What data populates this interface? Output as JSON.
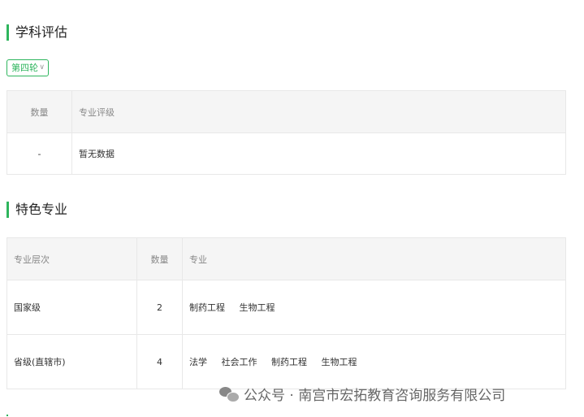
{
  "assessment": {
    "title": "学科评估",
    "round_select": "第四轮",
    "headers": [
      "数量",
      "专业评级"
    ],
    "row": [
      "-",
      "暂无数据"
    ]
  },
  "featured": {
    "title": "特色专业",
    "headers": [
      "专业层次",
      "数量",
      "专业"
    ],
    "rows": [
      {
        "level": "国家级",
        "count": "2",
        "majors": [
          "制药工程",
          "生物工程"
        ]
      },
      {
        "level": "省级(直辖市)",
        "count": "4",
        "majors": [
          "法学",
          "社会工作",
          "制药工程",
          "生物工程"
        ]
      }
    ]
  },
  "watermark": "公众号 · 南宫市宏拓教育咨询服务有限公司",
  "colors": {
    "accent": "#2eb55d"
  }
}
